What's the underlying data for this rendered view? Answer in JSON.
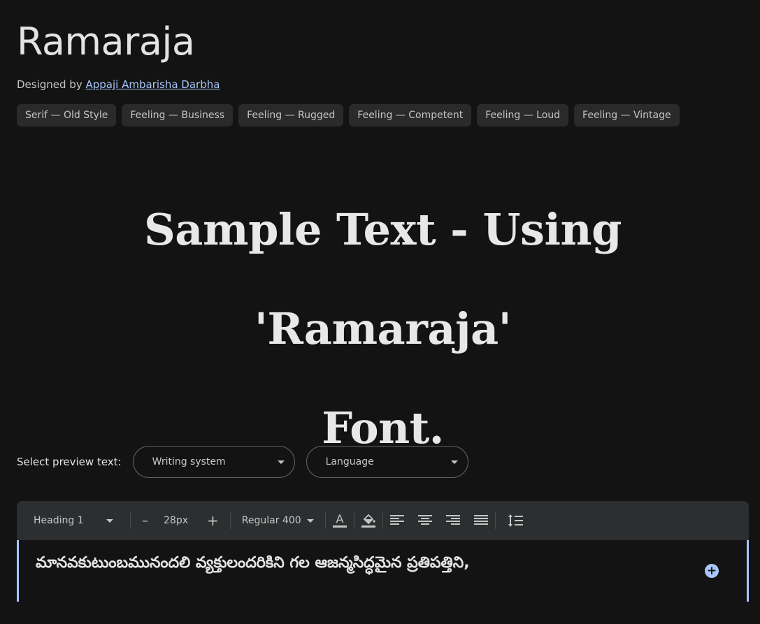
{
  "font": {
    "name": "Ramaraja",
    "designed_by_label": "Designed by",
    "designer": "Appaji Ambarisha Darbha"
  },
  "tags": [
    "Serif — Old Style",
    "Feeling — Business",
    "Feeling — Rugged",
    "Feeling — Competent",
    "Feeling — Loud",
    "Feeling — Vintage"
  ],
  "sample": {
    "line1": "Sample Text - Using 'Ramaraja'",
    "line2": "Font."
  },
  "preview_select": {
    "label": "Select preview text:",
    "writing_system": "Writing system",
    "language": "Language"
  },
  "toolbar": {
    "style": "Heading 1",
    "decrease": "–",
    "size": "28px",
    "increase": "+",
    "weight": "Regular 400"
  },
  "editor": {
    "text": "మానవకుటుంబమునందలి వ్యక్తులందరికిని గల ఆజన్మసిద్ధమైన ప్రతిపత్తిని,",
    "add_button": "+"
  },
  "colors": {
    "background": "#131313",
    "accent": "#a8c7fa",
    "toolbar": "#2d2e30"
  }
}
